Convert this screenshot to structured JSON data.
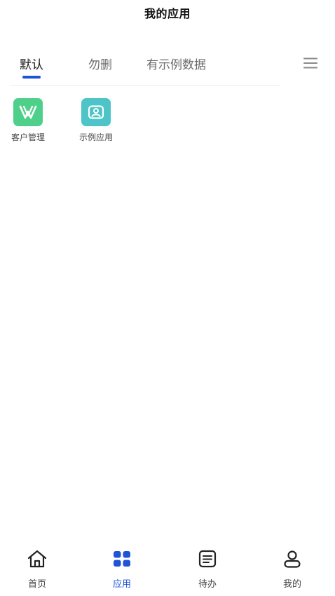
{
  "header": {
    "title": "我的应用"
  },
  "tabs": [
    {
      "label": "默认",
      "active": true
    },
    {
      "label": "勿删",
      "active": false
    },
    {
      "label": "有示例数据",
      "active": false
    }
  ],
  "tabs_menu_icon": "hamburger-menu-icon",
  "apps": [
    {
      "label": "客户管理",
      "icon": "customer-management-icon",
      "color": "#4fd08a"
    },
    {
      "label": "示例应用",
      "icon": "sample-app-icon",
      "color": "#4cc4c8"
    }
  ],
  "bottom_nav": [
    {
      "label": "首页",
      "icon": "home-icon",
      "active": false
    },
    {
      "label": "应用",
      "icon": "apps-grid-icon",
      "active": true
    },
    {
      "label": "待办",
      "icon": "todo-list-icon",
      "active": false
    },
    {
      "label": "我的",
      "icon": "user-icon",
      "active": false
    }
  ],
  "colors": {
    "accent": "#2054d6",
    "tab_active_text": "#1b1b1b",
    "tab_inactive_text": "#6a6a6a"
  }
}
